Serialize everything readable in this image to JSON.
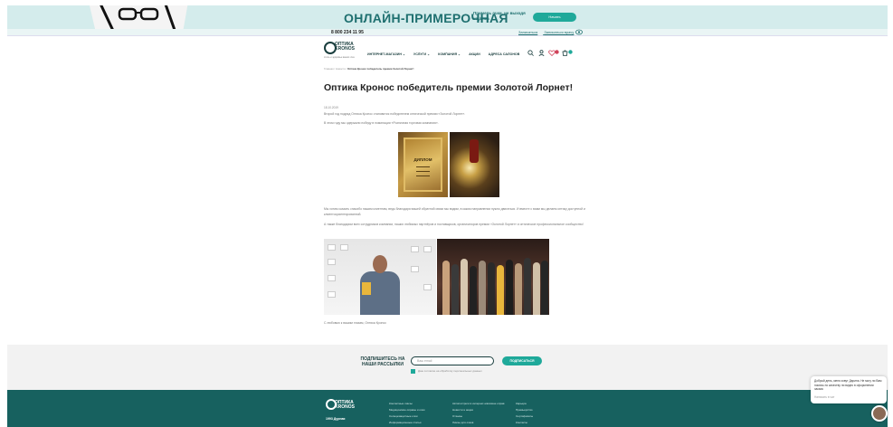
{
  "banner": {
    "title": "ОНЛАЙН-ПРИМЕРОЧНАЯ",
    "subtitle": "Примерь очки, не выходя из дома",
    "button": "Начать"
  },
  "topbar": {
    "phone": "8 800 234 11 95",
    "links": [
      "Записаться",
      "Записаться врачу"
    ]
  },
  "header": {
    "logo_line1": "ОПТИКА",
    "logo_line2": "KRONOS",
    "logo_tagline": "стиль и здоровье ваших глаз",
    "nav": [
      "ИНТЕРНЕТ-МАГАЗИН ⌄",
      "УСЛУГИ ⌄",
      "КОМПАНИЯ ⌄",
      "АКЦИИ",
      "АДРЕСА САЛОНОВ"
    ]
  },
  "breadcrumb": {
    "path": "Главная / Новости /",
    "current": "Оптика Кронос победитель премии Золотой Лорнет!"
  },
  "article": {
    "title": "Оптика Кронос победитель премии Золотой Лорнет!",
    "date": "18.10.2019",
    "para1": "Второй год подряд Оптика Кронос становится победителем оптической премии «Золотой Лорнет».",
    "para2": "В этом году мы одержали победу в номинации «Розничная торговая компания».",
    "diploma_word": "ДИПЛОМ",
    "para3": "Мы хотим сказать спасибо нашим клиентам, ведь благодаря вашей обратной связи мы видим, в каком направлении нужно двигаться. И вместе с вами мы делаем оптику доступной и клиентоориентированной.",
    "para4": "А также благодарим всех сотрудников компании, наших любимых партнёров и поставщиков, организаторов премии «Золотой Лорнет» и оптическое профессиональное сообщество!",
    "caption": "С любовью к вашим глазам, Оптика Кронос"
  },
  "subscribe": {
    "title": "ПОДПИШИТЕСЬ НА НАШИ РАССЫЛКИ",
    "placeholder": "Ваш email",
    "button": "ПОДПИСАТЬСЯ",
    "consent": "Даю согласие на обработку персональных данных"
  },
  "footer": {
    "year": "1993 Дурная",
    "col1": [
      "Контактные линзы",
      "Медицинские оправы и очки",
      "Солнцезащитные очки",
      "Информационные статьи"
    ],
    "col2": [
      "Автопостреги в интернет-магазине оправ",
      "Новости и акции",
      "Отзывы",
      "Линзы для очков"
    ],
    "col3": [
      "Карьера",
      "Премьерство",
      "Сертификаты",
      "Контакты"
    ]
  },
  "chat": {
    "message": "Добрый день, меня зовут Дарина. Не могу ли Вам помочь по качеству ли видео в оформлении заказа",
    "reply": "Написать в чат"
  },
  "colors": {
    "teal_dark": "#17615f",
    "teal_accent": "#1fa99a",
    "banner_bg": "#d4ecec"
  }
}
